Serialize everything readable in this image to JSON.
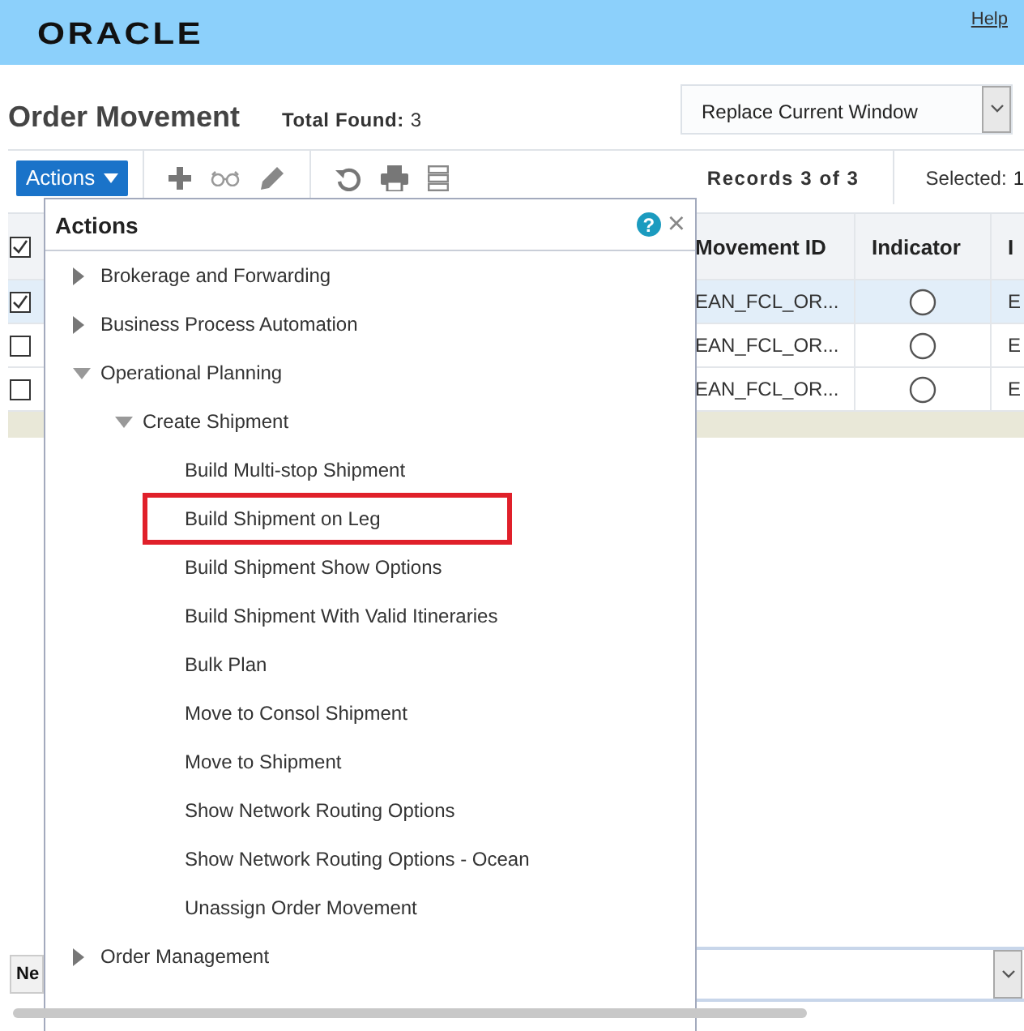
{
  "header": {
    "logo": "ORACLE",
    "help_link": "Help"
  },
  "heading": {
    "title": "Order Movement",
    "total_label": "Total Found:",
    "total_value": "3",
    "window_select": {
      "value": "Replace Current Window"
    }
  },
  "toolbar": {
    "actions_button": "Actions",
    "records": "Records 3 of 3",
    "selected_label": "Selected:",
    "selected_value": "1"
  },
  "table": {
    "header_checked": true,
    "columns": [
      "Movement ID",
      "Indicator",
      "I"
    ],
    "rows": [
      {
        "selected": true,
        "movement_id": "EAN_FCL_OR...",
        "indicator_on": false,
        "column_3": "E"
      },
      {
        "selected": false,
        "movement_id": "EAN_FCL_OR...",
        "indicator_on": false,
        "column_3": "E"
      },
      {
        "selected": false,
        "movement_id": "EAN_FCL_OR...",
        "indicator_on": false,
        "column_3": "E"
      }
    ]
  },
  "bottom_bar": {
    "button": "Ne"
  },
  "actions_popup": {
    "title": "Actions",
    "help_symbol": "?",
    "close_symbol": "×",
    "items": [
      {
        "label": "Brokerage and Forwarding",
        "expanded": false
      },
      {
        "label": "Business Process Automation",
        "expanded": false
      },
      {
        "label": "Operational Planning",
        "expanded": true,
        "children": [
          {
            "label": "Create Shipment",
            "expanded": true,
            "children": [
              {
                "label": "Build Multi-stop Shipment",
                "highlighted": false
              },
              {
                "label": "Build Shipment on Leg",
                "highlighted": true
              },
              {
                "label": "Build Shipment Show Options",
                "highlighted": false
              },
              {
                "label": "Build Shipment With Valid Itineraries",
                "highlighted": false
              },
              {
                "label": "Bulk Plan",
                "highlighted": false
              },
              {
                "label": "Move to Consol Shipment",
                "highlighted": false
              },
              {
                "label": "Move to Shipment",
                "highlighted": false
              },
              {
                "label": "Show Network Routing Options",
                "highlighted": false
              },
              {
                "label": "Show Network Routing Options - Ocean",
                "highlighted": false
              },
              {
                "label": "Unassign Order Movement",
                "highlighted": false
              }
            ]
          }
        ]
      },
      {
        "label": "Order Management",
        "expanded": false
      }
    ]
  }
}
